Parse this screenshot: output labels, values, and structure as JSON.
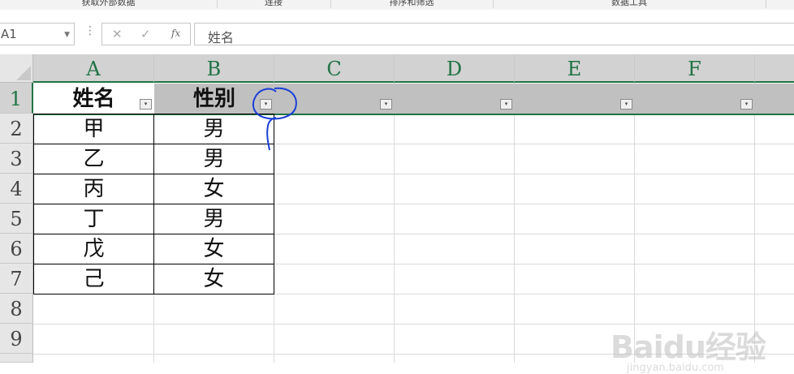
{
  "ribbon": {
    "groups": [
      "获取外部数据",
      "连接",
      "排序和筛选",
      "数据工具"
    ]
  },
  "formula_bar": {
    "name_box": "A1",
    "more_icon": "⋮",
    "cancel_icon": "✕",
    "enter_icon": "✓",
    "fx_label": "fx",
    "content": "姓名"
  },
  "columns": [
    "A",
    "B",
    "C",
    "D",
    "E",
    "F"
  ],
  "rows": [
    "1",
    "2",
    "3",
    "4",
    "5",
    "6",
    "7",
    "8",
    "9"
  ],
  "table": {
    "headers": [
      "姓名",
      "性别"
    ],
    "rows": [
      [
        "甲",
        "男"
      ],
      [
        "乙",
        "男"
      ],
      [
        "丙",
        "女"
      ],
      [
        "丁",
        "男"
      ],
      [
        "戊",
        "女"
      ],
      [
        "己",
        "女"
      ]
    ]
  },
  "filter_arrow": "▾",
  "watermark": {
    "logo": "Baidu经验",
    "url": "jingyan.baidu.com"
  },
  "colors": {
    "accent": "#217346",
    "annotation": "#1a3fd6",
    "header_band": "#c0c0c0"
  }
}
